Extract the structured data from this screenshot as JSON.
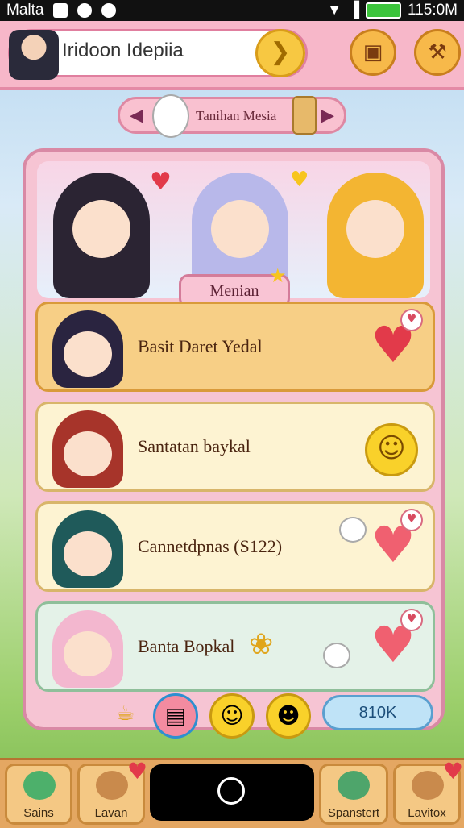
{
  "status": {
    "carrier": "Malta",
    "time": "115:0M"
  },
  "search": {
    "value": "Iridoon Idepiia"
  },
  "banner": {
    "title": "Tanihan Mesia"
  },
  "hero": {
    "title": "Menian"
  },
  "cards": [
    {
      "name": "Basit Daret Yedal",
      "action": "heart-icon",
      "bg": "#f7cf86",
      "border": "#d99a3a"
    },
    {
      "name": "Santatan baykal",
      "action": "pineapple-smile-icon",
      "bg": "#fdf3d2",
      "border": "#d8b56a"
    },
    {
      "name": "Cannetdpnas (S122)",
      "action": "heart-icon",
      "bg": "#fdf3d2",
      "border": "#d8b56a"
    },
    {
      "name": "Banta Bopkal",
      "action": "heart-icon",
      "bg": "#e4f2e8",
      "border": "#8fbf9a"
    }
  ],
  "panel_bottom": {
    "score": "810K"
  },
  "nav": [
    {
      "label": "Sains"
    },
    {
      "label": "Lavan"
    },
    {
      "label": "Spanstert"
    },
    {
      "label": "Lavitox"
    }
  ]
}
